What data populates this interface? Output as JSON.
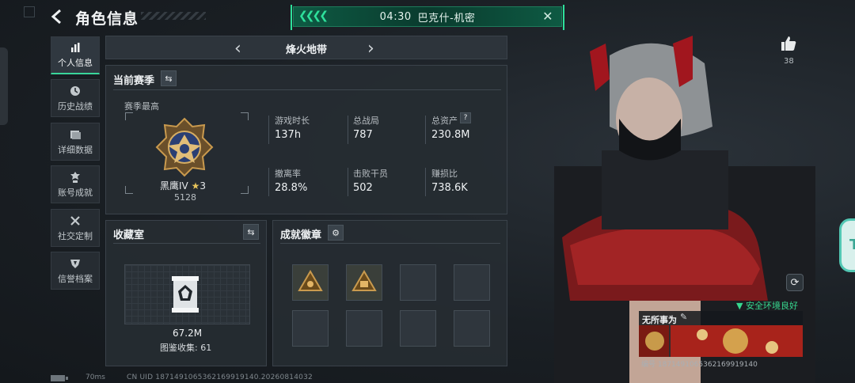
{
  "header": {
    "title": "角色信息",
    "mission": {
      "time": "04:30",
      "name": "巴克什-机密"
    }
  },
  "sidebar": {
    "items": [
      {
        "label": "个人信息",
        "icon": "bar-chart-icon",
        "active": true
      },
      {
        "label": "历史战绩",
        "icon": "clock-icon",
        "active": false
      },
      {
        "label": "详细数据",
        "icon": "folder-icon",
        "active": false
      },
      {
        "label": "账号成就",
        "icon": "medal-icon",
        "active": false
      },
      {
        "label": "社交定制",
        "icon": "tools-icon",
        "active": false
      },
      {
        "label": "信誉档案",
        "icon": "shield-icon",
        "active": false
      }
    ]
  },
  "mode": {
    "name": "烽火地带"
  },
  "season": {
    "title": "当前赛季",
    "best_label": "赛季最高",
    "rank_name": "黑鹰IV",
    "rank_stars": "3",
    "rank_points": "5128",
    "stats": [
      {
        "label": "游戏时长",
        "value": "137h"
      },
      {
        "label": "总战局",
        "value": "787"
      },
      {
        "label": "总资产",
        "value": "230.8M",
        "help": "?"
      },
      {
        "label": "撤离率",
        "value": "28.8%"
      },
      {
        "label": "击败干员",
        "value": "502"
      },
      {
        "label": "赚损比",
        "value": "738.6K"
      }
    ]
  },
  "collection": {
    "title": "收藏室",
    "value": "67.2M",
    "catalog_label": "图鉴收集:",
    "catalog_count": "61"
  },
  "achievements": {
    "title": "成就徽章",
    "slots_filled": 2,
    "slots_total": 8
  },
  "profile": {
    "likes": "38",
    "env_status": "安全环境良好",
    "player_name": "无所事为",
    "uid_small": "编号 1871491065362169919140"
  },
  "footer": {
    "ping": "70ms",
    "uid": "CN UID 1871491065362169919140.20260814032"
  },
  "colors": {
    "accent_green": "#39d59a",
    "banner_green": "#0e5a43",
    "panel_bg": "#262c32"
  }
}
